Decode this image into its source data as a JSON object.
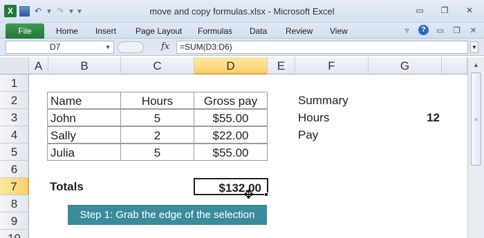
{
  "window": {
    "title": "move and copy formulas.xlsx  -  Microsoft Excel",
    "app_icon": "X"
  },
  "ribbon": {
    "file": "File",
    "tabs": [
      "Home",
      "Insert",
      "Page Layout",
      "Formulas",
      "Data",
      "Review",
      "View"
    ]
  },
  "formula_bar": {
    "name_box": "D7",
    "fx": "fx",
    "formula": "=SUM(D3:D6)"
  },
  "columns": [
    "A",
    "B",
    "C",
    "D",
    "E",
    "F",
    "G"
  ],
  "selected_column": "D",
  "rows": [
    "1",
    "2",
    "3",
    "4",
    "5",
    "6",
    "7",
    "8",
    "9",
    "10"
  ],
  "selected_row": "7",
  "table": {
    "headers": [
      "Name",
      "Hours",
      "Gross pay"
    ],
    "rows": [
      [
        "John",
        "5",
        "$55.00"
      ],
      [
        "Sally",
        "2",
        "$22.00"
      ],
      [
        "Julia",
        "5",
        "$55.00"
      ]
    ]
  },
  "summary": {
    "title": "Summary",
    "hours_label": "Hours",
    "hours_value": "12",
    "pay_label": "Pay"
  },
  "totals": {
    "label": "Totals",
    "value": "$132.00"
  },
  "callout": "Step 1: Grab the edge of the selection",
  "colors": {
    "callout": "#3a8b9b",
    "file_tab": "#2e8543",
    "selected_header": "#f8d06c"
  }
}
